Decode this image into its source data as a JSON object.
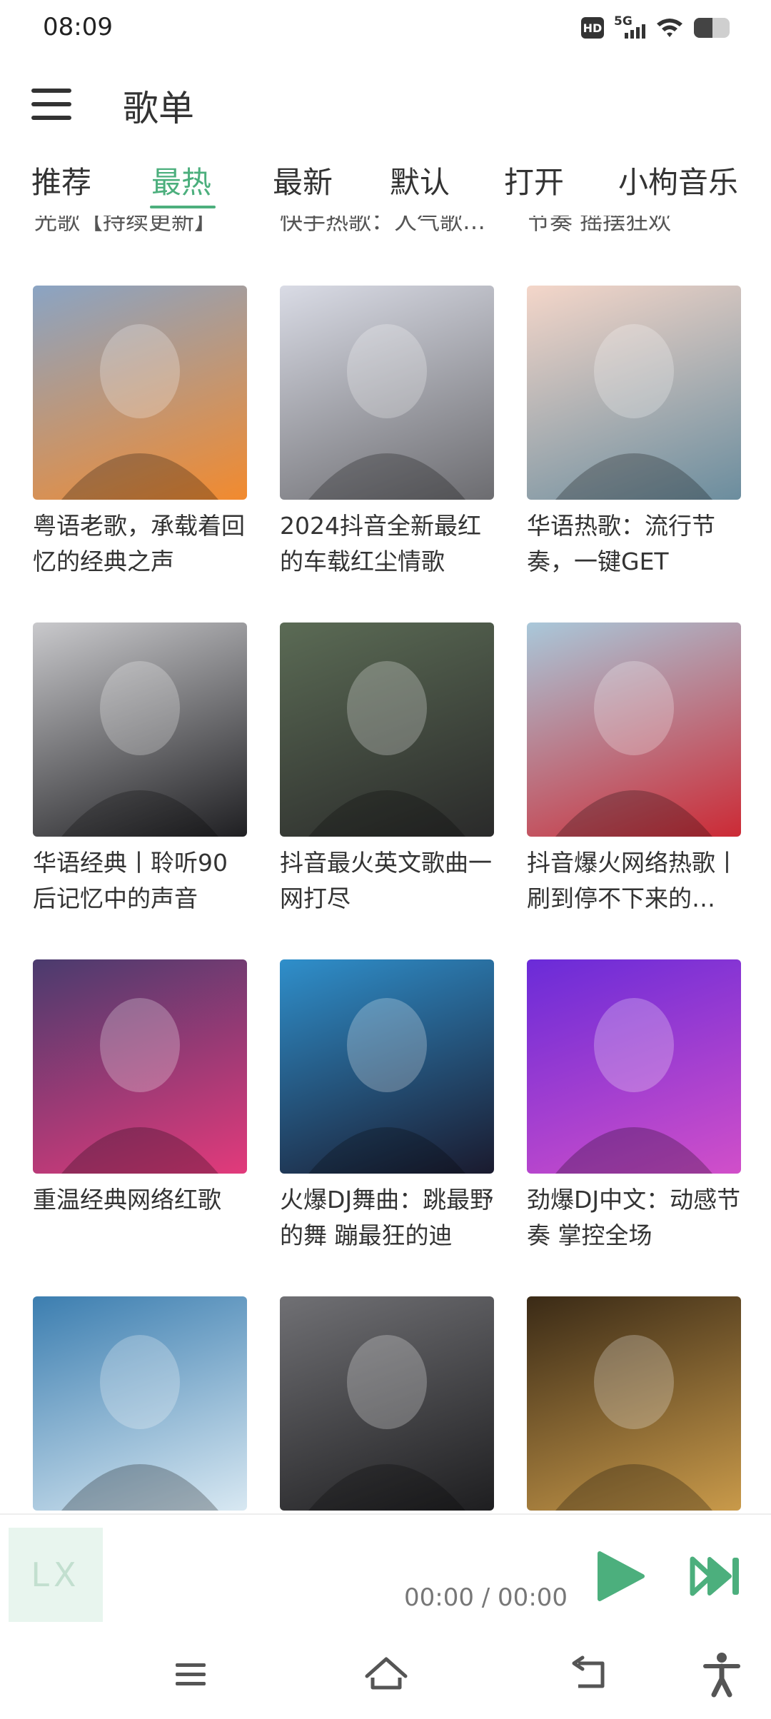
{
  "status": {
    "time": "08:09",
    "hd": "HD",
    "network": "5G",
    "battery_level": 0.52
  },
  "header": {
    "title": "歌单",
    "menu_icon": "menu-icon"
  },
  "tabs": [
    {
      "label": "推荐",
      "active": false
    },
    {
      "label": "最热",
      "active": true
    },
    {
      "label": "最新",
      "active": false
    },
    {
      "label": "默认",
      "active": false
    },
    {
      "label": "打开",
      "active": false
    },
    {
      "label": "小枸音乐",
      "active": false
    }
  ],
  "partial_titles": [
    "光歌【持续更新】",
    "快手热歌：人气歌…",
    "节奏 摇摆狂欢"
  ],
  "playlists": [
    {
      "title": "粤语老歌，承载着回忆的经典之声",
      "cover_colors": [
        "#8aa4c4",
        "#f28a2e"
      ]
    },
    {
      "title": "2024抖音全新最红的车载红尘情歌",
      "cover_colors": [
        "#d9dbe5",
        "#6c6c70"
      ]
    },
    {
      "title": "华语热歌：流行节奏，一键GET",
      "cover_colors": [
        "#f4d6c9",
        "#6b8d9e"
      ]
    },
    {
      "title": "华语经典丨聆听90后记忆中的声音",
      "cover_colors": [
        "#c9c9cc",
        "#1f1f22"
      ]
    },
    {
      "title": "抖音最火英文歌曲一网打尽",
      "cover_colors": [
        "#5b6b55",
        "#2a2a2a"
      ]
    },
    {
      "title": "抖音爆火网络热歌丨刷到停不下来的…",
      "cover_colors": [
        "#a9c8da",
        "#cc2a35"
      ]
    },
    {
      "title": "重温经典网络红歌",
      "cover_colors": [
        "#4a3b6e",
        "#e23a7b"
      ]
    },
    {
      "title": "火爆DJ舞曲：跳最野的舞 蹦最狂的迪",
      "cover_colors": [
        "#2f8fcb",
        "#1a1a2e"
      ]
    },
    {
      "title": "劲爆DJ中文：动感节奏 掌控全场",
      "cover_colors": [
        "#6a2bd8",
        "#d14fc9"
      ]
    },
    {
      "title": "",
      "cover_colors": [
        "#3c7eb0",
        "#d8e8f2"
      ]
    },
    {
      "title": "",
      "cover_colors": [
        "#707074",
        "#1e1e20"
      ]
    },
    {
      "title": "",
      "cover_colors": [
        "#3a2a16",
        "#c99a4a"
      ]
    }
  ],
  "player": {
    "logo_text": "LX",
    "time": "00:00 / 00:00",
    "accent": "#4caf7d"
  },
  "navbar": {
    "icons": [
      "menu-nav-icon",
      "home-icon",
      "back-icon",
      "accessibility-icon"
    ]
  }
}
